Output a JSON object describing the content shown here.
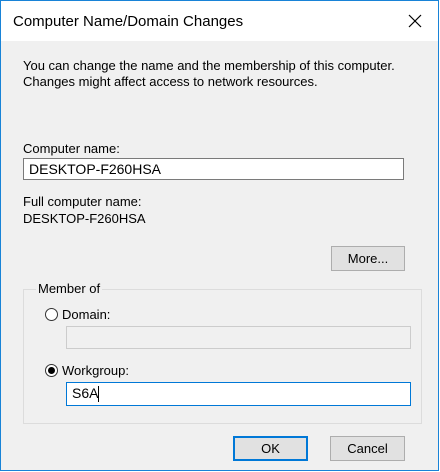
{
  "dialog": {
    "title": "Computer Name/Domain Changes",
    "description": "You can change the name and the membership of this computer. Changes might affect access to network resources."
  },
  "computer_name": {
    "label": "Computer name:",
    "value": "DESKTOP-F260HSA"
  },
  "full_computer_name": {
    "label": "Full computer name:",
    "value": "DESKTOP-F260HSA"
  },
  "buttons": {
    "more": "More...",
    "ok": "OK",
    "cancel": "Cancel"
  },
  "member_of": {
    "legend": "Member of",
    "domain_label": "Domain:",
    "domain_value": "",
    "domain_selected": false,
    "workgroup_label": "Workgroup:",
    "workgroup_value": "S6A",
    "workgroup_selected": true
  },
  "icons": {
    "close": "close-icon"
  },
  "colors": {
    "accent": "#0078d7",
    "window_border": "#1883d7",
    "dialog_bg": "#f0f0f0"
  }
}
